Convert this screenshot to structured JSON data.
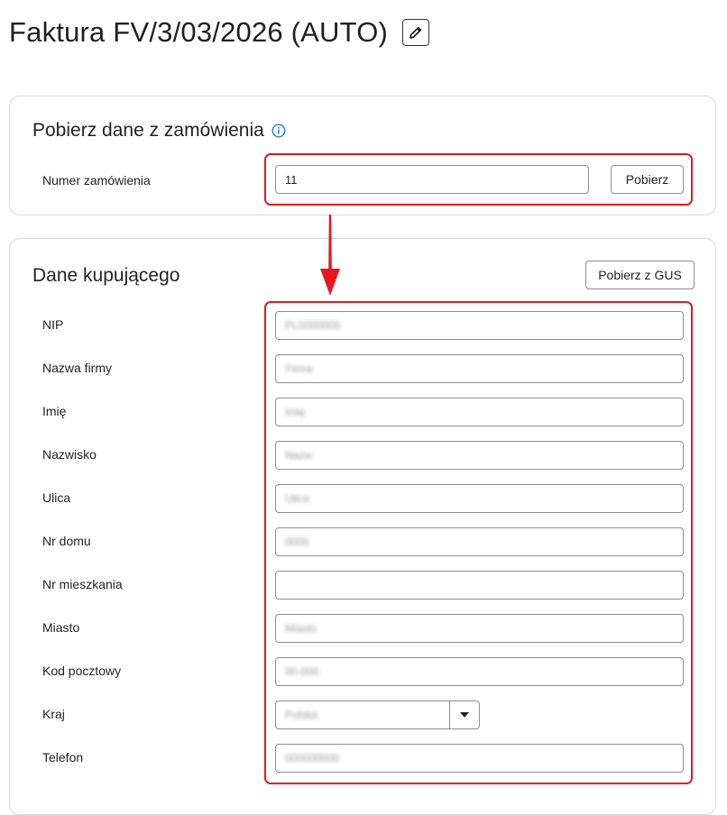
{
  "header": {
    "title": "Faktura FV/3/03/2026 (AUTO)",
    "edit_icon": "pencil-icon"
  },
  "order_section": {
    "title": "Pobierz dane z zamówienia",
    "info_icon": "info-circle-icon",
    "order_number_label": "Numer zamówienia",
    "order_number_value": "11",
    "fetch_button": "Pobierz"
  },
  "buyer_section": {
    "title": "Dane kupującego",
    "gus_button": "Pobierz z GUS",
    "fields": {
      "nip": {
        "label": "NIP",
        "value": "PL0000000"
      },
      "company": {
        "label": "Nazwa firmy",
        "value": "Firma"
      },
      "first_name": {
        "label": "Imię",
        "value": "Imię"
      },
      "last_name": {
        "label": "Nazwisko",
        "value": "Nazw"
      },
      "street": {
        "label": "Ulica",
        "value": "Ulica"
      },
      "house_no": {
        "label": "Nr domu",
        "value": "0000"
      },
      "apartment_no": {
        "label": "Nr mieszkania",
        "value": ""
      },
      "city": {
        "label": "Miasto",
        "value": "Miasto"
      },
      "postal_code": {
        "label": "Kod pocztowy",
        "value": "00-000"
      },
      "country": {
        "label": "Kraj",
        "value": "Polska"
      },
      "phone": {
        "label": "Telefon",
        "value": "000000000"
      }
    }
  },
  "colors": {
    "highlight": "#e8161e",
    "accent": "#1a73e8"
  }
}
